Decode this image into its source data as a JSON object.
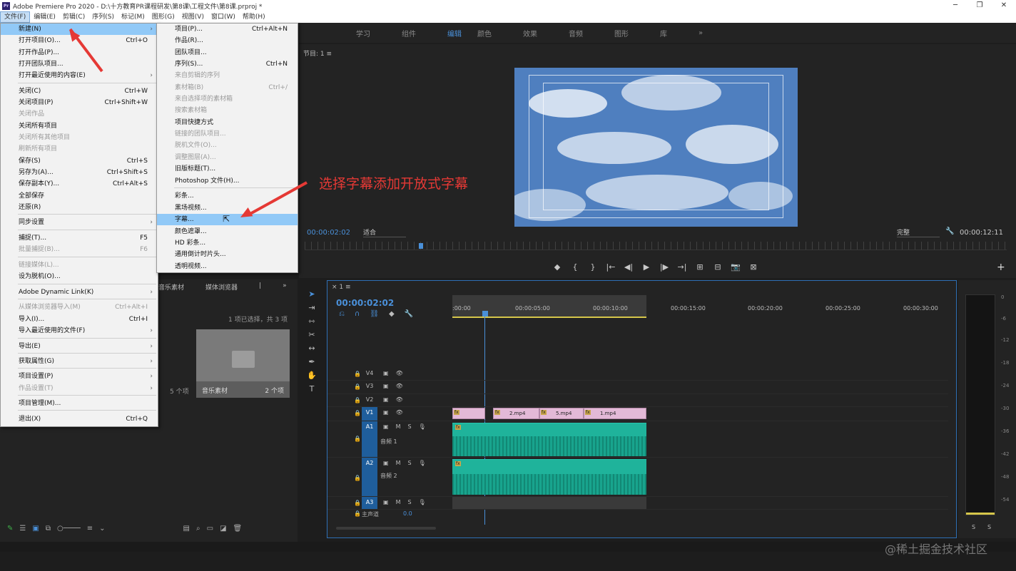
{
  "title": {
    "text": "Adobe Premiere Pro 2020 - D:\\十方教育PR课程研发\\第8课\\工程文件\\第8课.prproj *",
    "window_buttons": [
      "─",
      "❐",
      "✕"
    ]
  },
  "menubar": [
    "文件(F)",
    "编辑(E)",
    "剪辑(C)",
    "序列(S)",
    "标记(M)",
    "图形(G)",
    "视图(V)",
    "窗口(W)",
    "帮助(H)"
  ],
  "workspaces": [
    "学习",
    "组件",
    "编辑",
    "颜色",
    "效果",
    "音频",
    "图形",
    "库",
    "»"
  ],
  "workspace_active": "编辑",
  "file_menu": {
    "items": [
      {
        "label": "新建(N)",
        "shortcut": "",
        "arrow": "›",
        "disabled": false
      },
      {
        "label": "打开项目(O)...",
        "shortcut": "Ctrl+O",
        "arrow": "",
        "disabled": false
      },
      {
        "label": "打开作品(P)...",
        "shortcut": "",
        "arrow": "",
        "disabled": false
      },
      {
        "label": "打开团队项目...",
        "shortcut": "",
        "arrow": "",
        "disabled": false
      },
      {
        "label": "打开最近使用的内容(E)",
        "shortcut": "",
        "arrow": "›",
        "disabled": false
      },
      {
        "label": "关闭(C)",
        "shortcut": "Ctrl+W",
        "arrow": "",
        "disabled": false
      },
      {
        "label": "关闭项目(P)",
        "shortcut": "Ctrl+Shift+W",
        "arrow": "",
        "disabled": false
      },
      {
        "label": "关闭作品",
        "shortcut": "",
        "arrow": "",
        "disabled": true
      },
      {
        "label": "关闭所有项目",
        "shortcut": "",
        "arrow": "",
        "disabled": false
      },
      {
        "label": "关闭所有其他项目",
        "shortcut": "",
        "arrow": "",
        "disabled": true
      },
      {
        "label": "刷新所有项目",
        "shortcut": "",
        "arrow": "",
        "disabled": true
      },
      {
        "label": "保存(S)",
        "shortcut": "Ctrl+S",
        "arrow": "",
        "disabled": false
      },
      {
        "label": "另存为(A)...",
        "shortcut": "Ctrl+Shift+S",
        "arrow": "",
        "disabled": false
      },
      {
        "label": "保存副本(Y)...",
        "shortcut": "Ctrl+Alt+S",
        "arrow": "",
        "disabled": false
      },
      {
        "label": "全部保存",
        "shortcut": "",
        "arrow": "",
        "disabled": false
      },
      {
        "label": "还原(R)",
        "shortcut": "",
        "arrow": "",
        "disabled": false
      },
      {
        "label": "同步设置",
        "shortcut": "",
        "arrow": "›",
        "disabled": false
      },
      {
        "label": "捕捉(T)...",
        "shortcut": "F5",
        "arrow": "",
        "disabled": false
      },
      {
        "label": "批量捕捉(B)...",
        "shortcut": "F6",
        "arrow": "",
        "disabled": true
      },
      {
        "label": "链接媒体(L)...",
        "shortcut": "",
        "arrow": "",
        "disabled": true
      },
      {
        "label": "设为脱机(O)...",
        "shortcut": "",
        "arrow": "",
        "disabled": false
      },
      {
        "label": "Adobe Dynamic Link(K)",
        "shortcut": "",
        "arrow": "›",
        "disabled": false
      },
      {
        "label": "从媒体浏览器导入(M)",
        "shortcut": "Ctrl+Alt+I",
        "arrow": "",
        "disabled": true
      },
      {
        "label": "导入(I)...",
        "shortcut": "Ctrl+I",
        "arrow": "",
        "disabled": false
      },
      {
        "label": "导入最近使用的文件(F)",
        "shortcut": "",
        "arrow": "›",
        "disabled": false
      },
      {
        "label": "导出(E)",
        "shortcut": "",
        "arrow": "›",
        "disabled": false
      },
      {
        "label": "获取属性(G)",
        "shortcut": "",
        "arrow": "›",
        "disabled": false
      },
      {
        "label": "项目设置(P)",
        "shortcut": "",
        "arrow": "›",
        "disabled": false
      },
      {
        "label": "作品设置(T)",
        "shortcut": "",
        "arrow": "›",
        "disabled": true
      },
      {
        "label": "项目管理(M)...",
        "shortcut": "",
        "arrow": "",
        "disabled": false
      },
      {
        "label": "退出(X)",
        "shortcut": "Ctrl+Q",
        "arrow": "",
        "disabled": false
      }
    ]
  },
  "new_submenu": {
    "items": [
      {
        "label": "项目(P)...",
        "shortcut": "Ctrl+Alt+N",
        "disabled": false
      },
      {
        "label": "作品(R)...",
        "shortcut": "",
        "disabled": false
      },
      {
        "label": "团队项目...",
        "shortcut": "",
        "disabled": false
      },
      {
        "label": "序列(S)...",
        "shortcut": "Ctrl+N",
        "disabled": false
      },
      {
        "label": "来自剪辑的序列",
        "shortcut": "",
        "disabled": true
      },
      {
        "label": "素材箱(B)",
        "shortcut": "Ctrl+/",
        "disabled": true
      },
      {
        "label": "来自选择项的素材箱",
        "shortcut": "",
        "disabled": true
      },
      {
        "label": "搜索素材箱",
        "shortcut": "",
        "disabled": true
      },
      {
        "label": "项目快捷方式",
        "shortcut": "",
        "disabled": false
      },
      {
        "label": "链接的团队项目...",
        "shortcut": "",
        "disabled": true
      },
      {
        "label": "脱机文件(O)...",
        "shortcut": "",
        "disabled": true
      },
      {
        "label": "调整图层(A)...",
        "shortcut": "",
        "disabled": true
      },
      {
        "label": "旧版标题(T)...",
        "shortcut": "",
        "disabled": false
      },
      {
        "label": "Photoshop 文件(H)...",
        "shortcut": "",
        "disabled": false
      },
      {
        "label": "彩条...",
        "shortcut": "",
        "disabled": false
      },
      {
        "label": "黑场视频...",
        "shortcut": "",
        "disabled": false
      },
      {
        "label": "字幕...",
        "shortcut": "",
        "disabled": false
      },
      {
        "label": "颜色遮罩...",
        "shortcut": "",
        "disabled": false
      },
      {
        "label": "HD 彩条...",
        "shortcut": "",
        "disabled": false
      },
      {
        "label": "通用倒计时片头...",
        "shortcut": "",
        "disabled": false
      },
      {
        "label": "透明视频...",
        "shortcut": "",
        "disabled": false
      }
    ],
    "highlighted": "字幕..."
  },
  "annotation": "选择字幕添加开放式字幕",
  "program_monitor": {
    "title": "节目: 1 ≡",
    "timecode_left": "00:00:02:02",
    "fit": "适合",
    "quality": "完整",
    "timecode_right": "00:00:12:11",
    "controls": [
      "◆",
      "{",
      "}",
      "|←",
      "◀|",
      "▶",
      "|▶",
      "→|",
      "⊞",
      "⊟",
      "📷",
      "⊠"
    ]
  },
  "project_panel": {
    "tabs": [
      "音乐素材",
      "媒体浏览器",
      "|",
      "»"
    ],
    "selection_count": "1 项已选择，共 3 项",
    "bin_name": "音乐素材",
    "bin_count": "2 个项",
    "left_count": "5 个项"
  },
  "timeline": {
    "title": "×  1 ≡",
    "timecode": "00:00:02:02",
    "ruler_ticks": [
      ":00:00",
      "00:00:05:00",
      "00:00:10:00",
      "00:00:15:00",
      "00:00:20:00",
      "00:00:25:00",
      "00:00:30:00"
    ],
    "video_tracks": [
      "V4",
      "V3",
      "V2",
      "V1"
    ],
    "audio_tracks": [
      {
        "name": "A1",
        "label": "音频 1"
      },
      {
        "name": "A2",
        "label": "音频 2"
      },
      {
        "name": "A3",
        "label": ""
      }
    ],
    "master": "主声道",
    "master_value": "0.0",
    "clips": [
      "2.mp4",
      "5.mp4",
      "1.mp4"
    ],
    "fx_label": "fx"
  },
  "meters": {
    "scale": [
      "0",
      "-6",
      "-12",
      "-18",
      "-24",
      "-30",
      "-36",
      "-42",
      "-48",
      "-54"
    ],
    "solo": [
      "S",
      "S"
    ]
  },
  "watermark": "@稀土掘金技术社区",
  "colors": {
    "accent": "#4a90d9",
    "annotation": "#e53935",
    "video_clip": "#e3b9d7",
    "audio_clip": "#1fb39b"
  }
}
